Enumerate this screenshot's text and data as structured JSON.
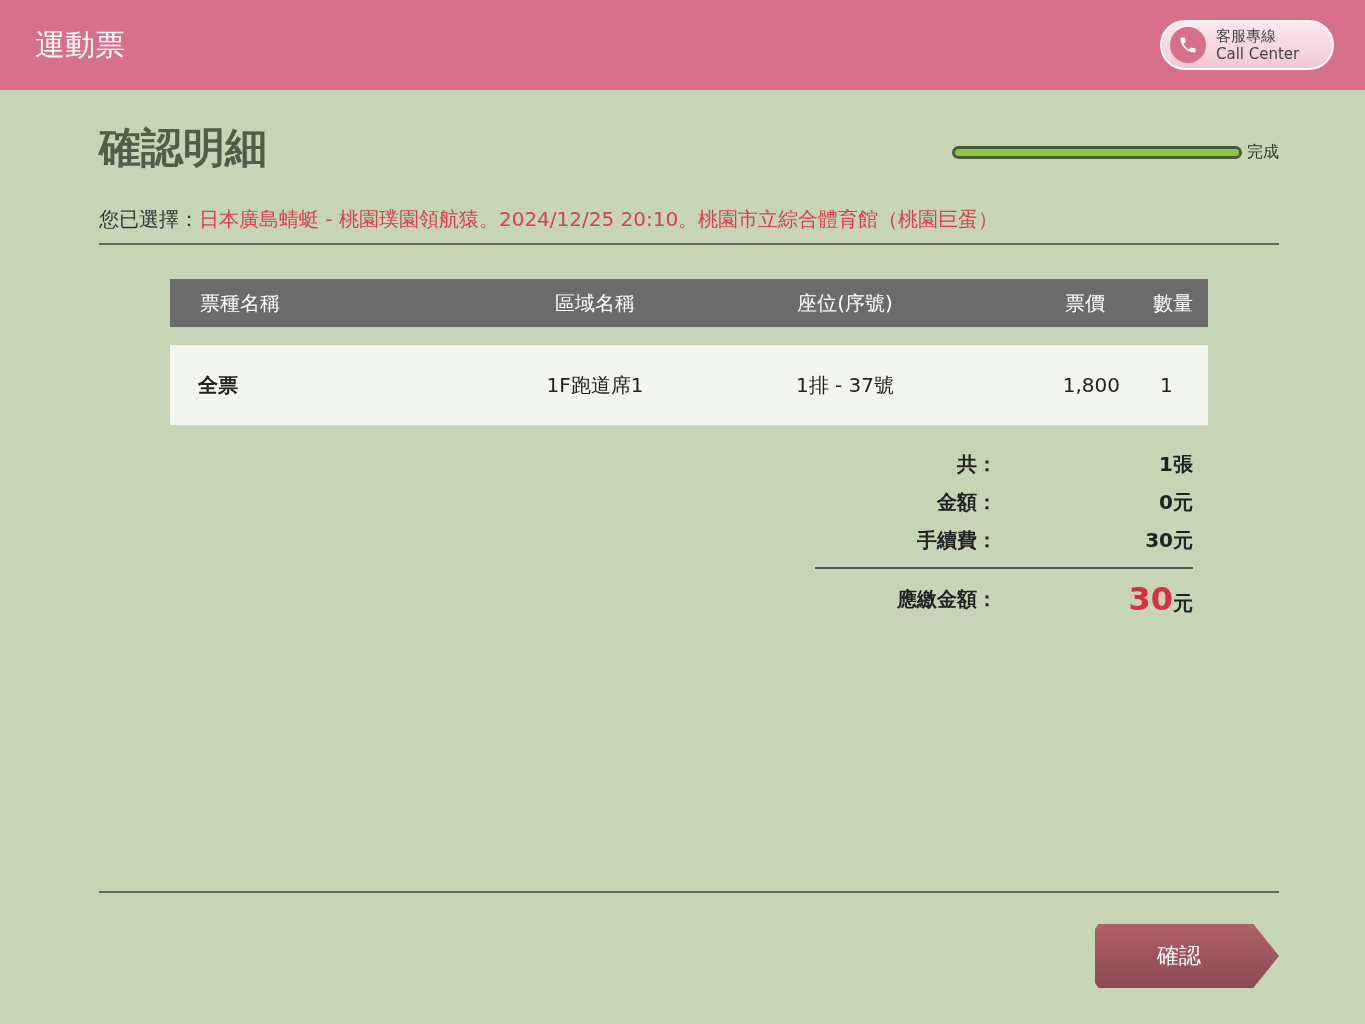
{
  "header": {
    "title": "運動票",
    "call_center": {
      "line1": "客服專線",
      "line2": "Call Center"
    }
  },
  "page_title": "確認明細",
  "progress": {
    "level": 1,
    "label": "完成"
  },
  "selection": {
    "label": "您已選擇：",
    "value": "日本廣島蜻蜓 - 桃園璞園領航猿。2024/12/25 20:10。桃園市立綜合體育館（桃園巨蛋）"
  },
  "table": {
    "columns": [
      "票種名稱",
      "區域名稱",
      "座位(序號)",
      "票價",
      "數量"
    ],
    "rows": [
      [
        "全票",
        "1F跑道席1",
        "1排 - 37號",
        "1,800",
        "1"
      ]
    ]
  },
  "summary": [
    {
      "label": "共：",
      "value": "1張"
    },
    {
      "label": "金額：",
      "value": "0元"
    },
    {
      "label": "手續費：",
      "value": "30元"
    }
  ],
  "total": {
    "label": "應繳金額：",
    "amount": "30",
    "unit": "元"
  },
  "confirm_button": "確認"
}
